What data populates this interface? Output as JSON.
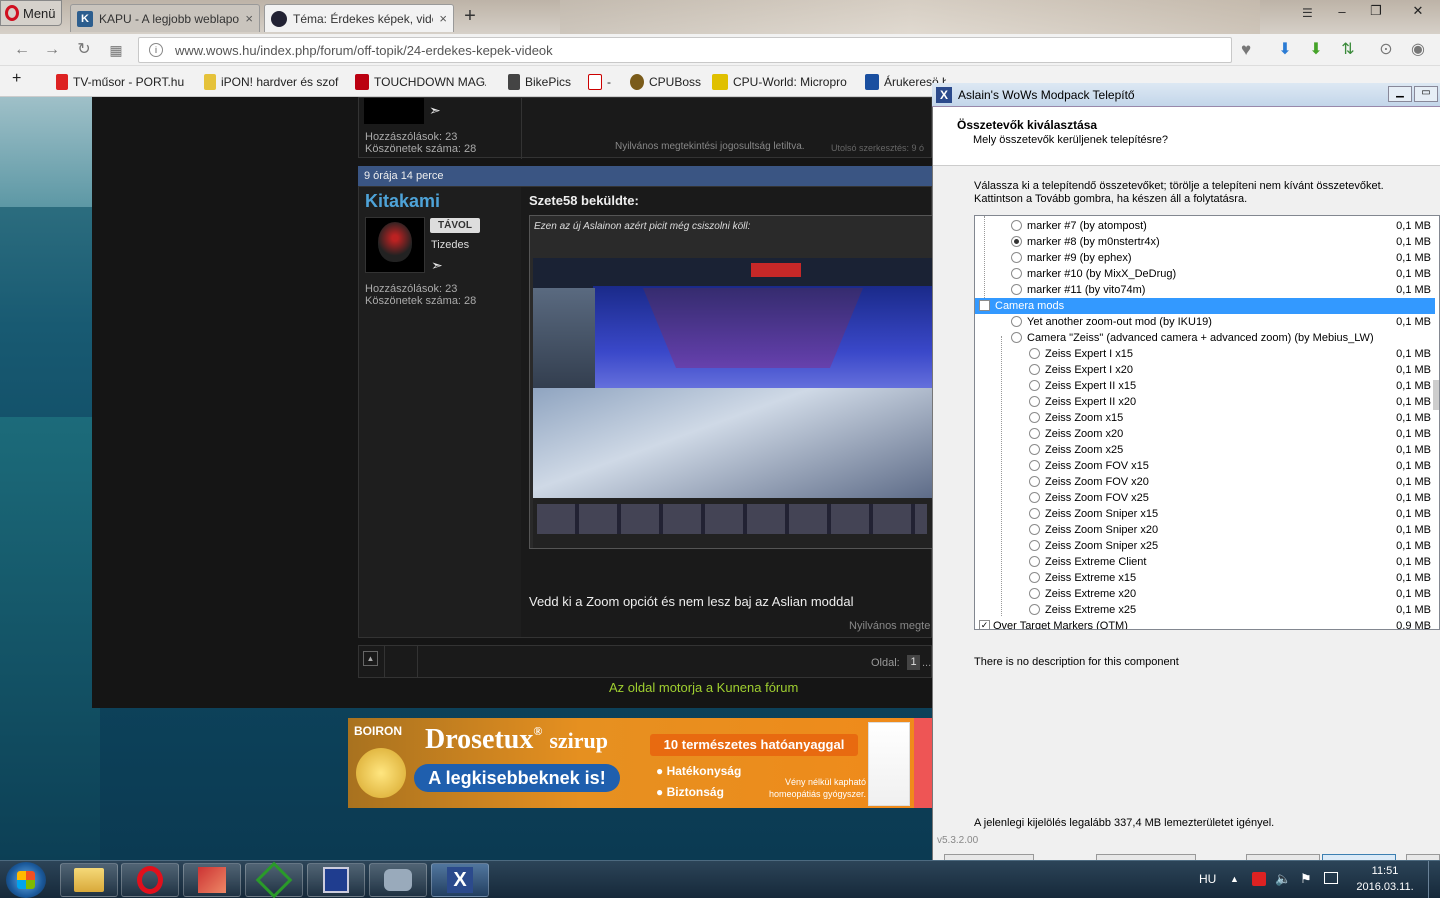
{
  "browser": {
    "menu_label": "Menü",
    "tabs": [
      {
        "label": "KAPU - A legjobb weblapo",
        "close": "×"
      },
      {
        "label": "Téma: Érdekes képek, vide",
        "close": "×"
      }
    ],
    "new_tab": "+",
    "window_controls": {
      "minimize": "–",
      "maximize": "❐",
      "close": "✕"
    },
    "url": "www.wows.hu/index.php/forum/off-topik/24-erdekes-kepek-videok",
    "bookmarks": [
      "TV-műsor - PORT.hu",
      "iPON! hardver és szof",
      "TOUCHDOWN MAGA",
      "BikePics",
      "-",
      "CPUBoss",
      "CPU-World: Micropro",
      "Árukeresö.hu - Árö"
    ]
  },
  "forum": {
    "prev_post": {
      "posts_label": "Hozzászólások: 23",
      "thanks_label": "Köszönetek száma: 28",
      "footer": "Nyilvános megtekintési jogosultság letiltva.",
      "edited": "Utolsó szerkesztés: 9 ó"
    },
    "post": {
      "time": "9 órája 14 perce",
      "username": "Kitakami",
      "status_badge": "TÁVOL",
      "rank": "Tizedes",
      "posts_label": "Hozzászólások: 23",
      "thanks_label": "Köszönetek száma: 28",
      "quote_author": "Szete58 beküldte:",
      "quote_text": "Ezen az új Aslainon azért picit még csiszolni köll:",
      "body": "Vedd ki a Zoom opciót és nem lesz baj az Aslian moddal",
      "footer": "Nyilvános megte"
    },
    "pagination": {
      "label": "Oldal:",
      "page": "1",
      "more": "..."
    },
    "engine_text": "Az oldal motorja a Kunena fórum"
  },
  "ad": {
    "brand": "BOIRON",
    "product": "Drosetux",
    "reg": "®",
    "product_suffix": "szirup",
    "tagline": "A legkisebbeknek is!",
    "badge": "10 természetes hatóanyaggal",
    "point1": "Hatékonyság",
    "point2": "Biztonság",
    "note": "Vény nélkül kapható homeopátiás gyógyszer."
  },
  "installer": {
    "title": "Aslain's WoWs Modpack Telepítő",
    "heading": "Összetevők kiválasztása",
    "subheading": "Mely összetevők kerüljenek telepítésre?",
    "instructions_1": "Válassza ki a telepítendő összetevőket; törölje a telepíteni nem kívánt összetevőket.",
    "instructions_2": "Kattintson a Tovább gombra, ha készen áll a folytatásra.",
    "components": [
      {
        "label": "marker #7 (by atompost)",
        "size": "0,1 MB",
        "type": "radio",
        "level": 1,
        "checked": false
      },
      {
        "label": "marker #8 (by m0nstertr4x)",
        "size": "0,1 MB",
        "type": "radio",
        "level": 1,
        "checked": true
      },
      {
        "label": "marker #9 (by ephex)",
        "size": "0,1 MB",
        "type": "radio",
        "level": 1,
        "checked": false
      },
      {
        "label": "marker #10 (by MixX_DeDrug)",
        "size": "0,1 MB",
        "type": "radio",
        "level": 1,
        "checked": false
      },
      {
        "label": "marker #11 (by vito74m)",
        "size": "0,1 MB",
        "type": "radio",
        "level": 1,
        "checked": false
      },
      {
        "label": "Camera mods",
        "size": "",
        "type": "check",
        "level": 0,
        "checked": false,
        "selected": true
      },
      {
        "label": "Yet another zoom-out mod (by IKU19)",
        "size": "0,1 MB",
        "type": "radio",
        "level": 1,
        "checked": false
      },
      {
        "label": "Camera \"Zeiss\" (advanced camera + advanced zoom) (by Mebius_LW)",
        "size": "",
        "type": "radio",
        "level": 1,
        "checked": false
      },
      {
        "label": "Zeiss Expert I x15",
        "size": "0,1 MB",
        "type": "radio",
        "level": 2,
        "checked": false
      },
      {
        "label": "Zeiss Expert I x20",
        "size": "0,1 MB",
        "type": "radio",
        "level": 2,
        "checked": false
      },
      {
        "label": "Zeiss Expert II x15",
        "size": "0,1 MB",
        "type": "radio",
        "level": 2,
        "checked": false
      },
      {
        "label": "Zeiss Expert II x20",
        "size": "0,1 MB",
        "type": "radio",
        "level": 2,
        "checked": false
      },
      {
        "label": "Zeiss Zoom x15",
        "size": "0,1 MB",
        "type": "radio",
        "level": 2,
        "checked": false
      },
      {
        "label": "Zeiss Zoom x20",
        "size": "0,1 MB",
        "type": "radio",
        "level": 2,
        "checked": false
      },
      {
        "label": "Zeiss Zoom x25",
        "size": "0,1 MB",
        "type": "radio",
        "level": 2,
        "checked": false
      },
      {
        "label": "Zeiss Zoom FOV x15",
        "size": "0,1 MB",
        "type": "radio",
        "level": 2,
        "checked": false
      },
      {
        "label": "Zeiss Zoom FOV x20",
        "size": "0,1 MB",
        "type": "radio",
        "level": 2,
        "checked": false
      },
      {
        "label": "Zeiss Zoom FOV x25",
        "size": "0,1 MB",
        "type": "radio",
        "level": 2,
        "checked": false
      },
      {
        "label": "Zeiss Zoom Sniper x15",
        "size": "0,1 MB",
        "type": "radio",
        "level": 2,
        "checked": false
      },
      {
        "label": "Zeiss Zoom Sniper x20",
        "size": "0,1 MB",
        "type": "radio",
        "level": 2,
        "checked": false
      },
      {
        "label": "Zeiss Zoom Sniper x25",
        "size": "0,1 MB",
        "type": "radio",
        "level": 2,
        "checked": false
      },
      {
        "label": "Zeiss Extreme Client",
        "size": "0,1 MB",
        "type": "radio",
        "level": 2,
        "checked": false
      },
      {
        "label": "Zeiss Extreme x15",
        "size": "0,1 MB",
        "type": "radio",
        "level": 2,
        "checked": false
      },
      {
        "label": "Zeiss Extreme x20",
        "size": "0,1 MB",
        "type": "radio",
        "level": 2,
        "checked": false
      },
      {
        "label": "Zeiss Extreme x25",
        "size": "0,1 MB",
        "type": "radio",
        "level": 2,
        "checked": false
      },
      {
        "label": "Over Target Markers (OTM)",
        "size": "0,9 MB",
        "type": "check",
        "level": 0,
        "checked": true
      }
    ],
    "description": "There is no description for this component",
    "space_required": "A jelenlegi kijelölés legalább 337,4 MB lemezterületet igényel.",
    "version": "v5.3.2.00"
  },
  "taskbar": {
    "language": "HU",
    "time": "11:51",
    "date": "2016.03.11.",
    "tray_up": "▲"
  }
}
